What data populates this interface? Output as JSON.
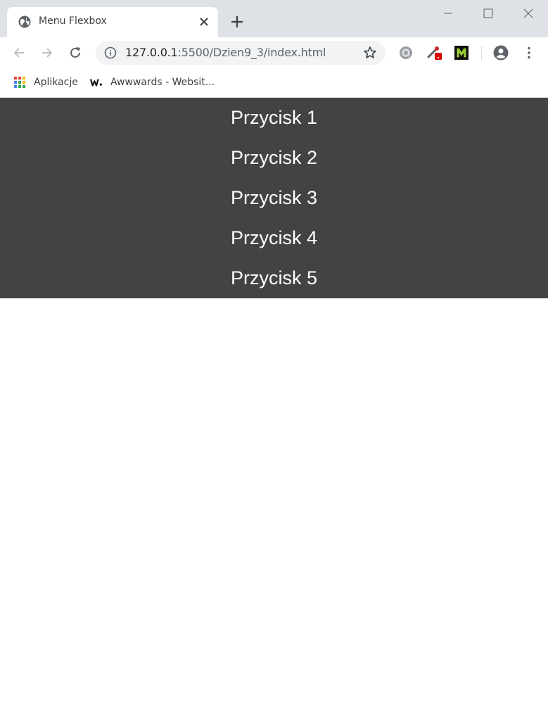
{
  "browser": {
    "tab": {
      "title": "Menu Flexbox"
    },
    "address": {
      "host": "127.0.0.1",
      "path": ":5500/Dzien9_3/index.html"
    },
    "bookmarks": [
      {
        "label": "Aplikacje",
        "icon": "apps-grid-icon"
      },
      {
        "label": "Awwwards - Websit...",
        "icon": "awwwards-icon"
      }
    ],
    "extensions": [
      "gear-extension-icon",
      "eyedropper-extension-icon",
      "m-extension-icon"
    ]
  },
  "page": {
    "menu": {
      "background": "#434343",
      "items": [
        {
          "label": "Przycisk 1"
        },
        {
          "label": "Przycisk 2"
        },
        {
          "label": "Przycisk 3"
        },
        {
          "label": "Przycisk 4"
        },
        {
          "label": "Przycisk 5"
        }
      ]
    }
  }
}
